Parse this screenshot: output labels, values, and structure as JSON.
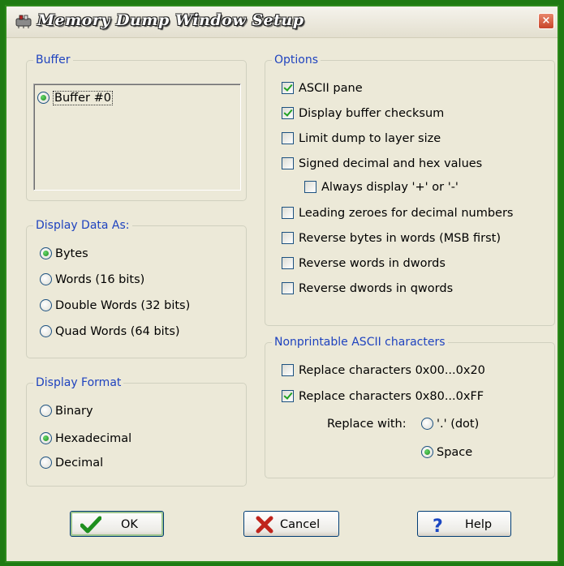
{
  "window": {
    "title": "Memory Dump Window Setup",
    "close_symbol": "×"
  },
  "buffer": {
    "title": "Buffer",
    "items": [
      {
        "label": "Buffer #0",
        "selected": true
      }
    ]
  },
  "display_data_as": {
    "title": "Display Data As:",
    "options": [
      {
        "label": "Bytes",
        "selected": true
      },
      {
        "label": "Words (16 bits)",
        "selected": false
      },
      {
        "label": "Double Words (32 bits)",
        "selected": false
      },
      {
        "label": "Quad Words (64 bits)",
        "selected": false
      }
    ]
  },
  "display_format": {
    "title": "Display Format",
    "options": [
      {
        "label": "Binary",
        "selected": false
      },
      {
        "label": "Hexadecimal",
        "selected": true
      },
      {
        "label": "Decimal",
        "selected": false
      }
    ]
  },
  "options": {
    "title": "Options",
    "items": [
      {
        "label": "ASCII pane",
        "checked": true
      },
      {
        "label": "Display buffer checksum",
        "checked": true
      },
      {
        "label": "Limit dump to layer size",
        "checked": false
      },
      {
        "label": "Signed decimal and hex values",
        "checked": false
      },
      {
        "label": "Always display '+' or '-'",
        "checked": false
      },
      {
        "label": "Leading zeroes for decimal numbers",
        "checked": false
      },
      {
        "label": "Reverse bytes in words (MSB first)",
        "checked": false
      },
      {
        "label": "Reverse words in dwords",
        "checked": false
      },
      {
        "label": "Reverse dwords in qwords",
        "checked": false
      }
    ]
  },
  "nonprintable": {
    "title": "Nonprintable ASCII characters",
    "items": [
      {
        "label": "Replace characters 0x00...0x20",
        "checked": false
      },
      {
        "label": "Replace characters 0x80...0xFF",
        "checked": true
      }
    ],
    "replace_with_label": "Replace with:",
    "replace_options": [
      {
        "label": "'.' (dot)",
        "selected": false
      },
      {
        "label": "Space",
        "selected": true
      }
    ]
  },
  "buttons": {
    "ok": "OK",
    "cancel": "Cancel",
    "help": "Help"
  },
  "colors": {
    "frame": "#1f7a12",
    "group_title": "#1f43bf",
    "dialog_bg": "#ece9d8"
  },
  "icons": {
    "title": "memory-chip-icon",
    "ok": "green-checkmark-icon",
    "cancel": "red-x-icon",
    "help": "blue-question-icon"
  }
}
